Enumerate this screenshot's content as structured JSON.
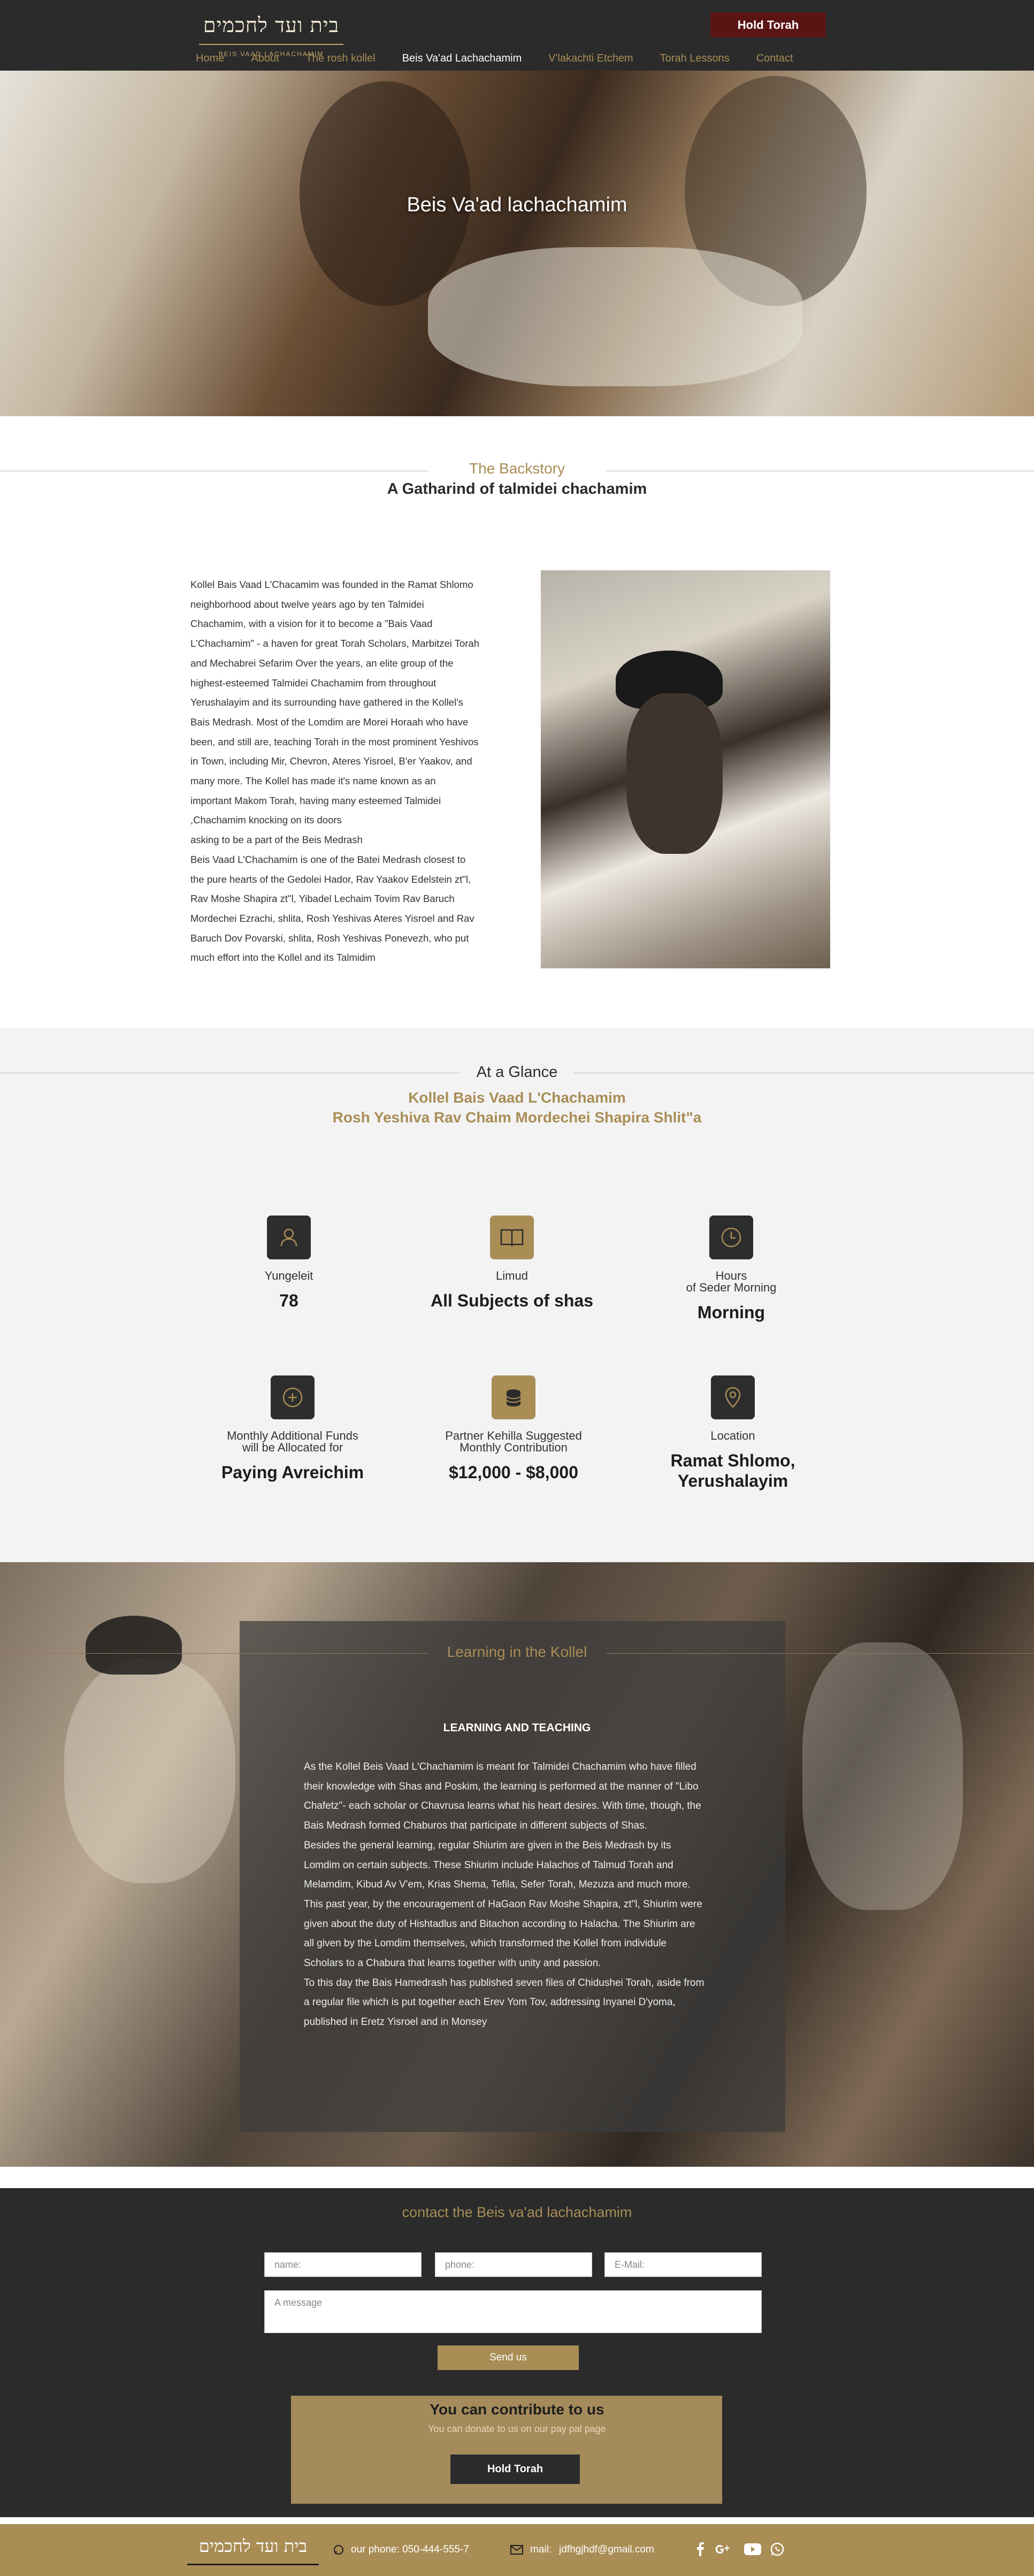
{
  "header": {
    "logo_text": "בית ועד לחכמים",
    "logo_sub": "BEIS VAAD LACHACHAMIM",
    "cta_label": "Hold  Torah",
    "nav": [
      "Home",
      "About",
      "The rosh kollel",
      "Beis Va'ad Lachachamim",
      "V'lakachti Etchem",
      "Torah Lessons",
      "Contact"
    ],
    "active_nav": "Beis Va'ad Lachachamim"
  },
  "hero": {
    "title": "Beis Va'ad lachachamim"
  },
  "backstory": {
    "kicker": "The Backstory",
    "title": "A Gatharind of talmidei chachamim",
    "body": "Kollel Bais Vaad L'Chacamim was founded in the Ramat Shlomo\nneighborhood about twelve years ago by ten Talmidei\nChachamim, with a vision for it to become a \"Bais Vaad\nL'Chachamim\" - a haven for great Torah Scholars, Marbitzei Torah\nand Mechabrei Sefarim Over the years, an elite group of the\nhighest-esteemed Talmidei Chachamim from throughout\nYerushalayim and its surrounding have gathered in the Kollel's\nBais Medrash. Most of the Lomdim are Morei Horaah who have\nbeen, and still are, teaching Torah in the most prominent Yeshivos\nin Town, including Mir, Chevron, Ateres Yisroel, B'er Yaakov, and\nmany more. The Kollel has made it's name known as an\nimportant Makom Torah, having many esteemed Talmidei\n,Chachamim knocking on its doors\nasking to be a part of the Beis Medrash\nBeis Vaad L'Chachamim is one of the Batei Medrash closest to\nthe pure hearts of the Gedolei Hador, Rav Yaakov Edelstein zt\"l,\nRav Moshe Shapira zt\"l, Yibadel Lechaim Tovim Rav Baruch\nMordechei Ezrachi, shlita, Rosh Yeshivas Ateres Yisroel and Rav\nBaruch Dov Povarski, shlita, Rosh Yeshivas Ponevezh, who put\n much effort into the Kollel and its Talmidim"
  },
  "glance": {
    "title": "At a Glance",
    "subtitle1": "Kollel Bais Vaad L'Chachamim",
    "subtitle2": "Rosh Yeshiva Rav Chaim Mordechei Shapira Shlit\"a",
    "stats": [
      {
        "icon": "person-icon",
        "label": "Yungeleit",
        "value": "78"
      },
      {
        "icon": "book-icon",
        "label": "Limud",
        "value": "All Subjects of shas"
      },
      {
        "icon": "clock-icon",
        "label": "Hours\nof Seder Morning",
        "value": "Morning"
      },
      {
        "icon": "plus-circle-icon",
        "label": "Monthly Additional Funds\nwill be Allocated for",
        "value": "Paying Avreichim"
      },
      {
        "icon": "coins-icon",
        "label": "Partner Kehilla Suggested\nMonthly Contribution",
        "value": "$12,000 - $8,000"
      },
      {
        "icon": "location-pin-icon",
        "label": "Location",
        "value": "Ramat Shlomo,\nYerushalayim"
      }
    ]
  },
  "learning": {
    "title": "Learning in the Kollel",
    "heading": "LEARNING AND TEACHING",
    "body": "As the Kollel Beis Vaad L'Chachamim is meant for Talmidei Chachamim who have filled\ntheir knowledge with Shas and Poskim, the learning is performed at the manner of \"Libo\nChafetz\"- each scholar or Chavrusa learns what his heart desires. With time, though, the\nBais Medrash formed Chaburos that participate in different subjects of Shas.\nBesides the general learning, regular Shiurim are given in the Beis Medrash by its\nLomdim on certain subjects. These Shiurim include Halachos of Talmud Torah and\nMelamdim, Kibud Av V'em, Krias Shema, Tefila, Sefer Torah, Mezuza and much more.\nThis past year, by the encouragement of HaGaon Rav Moshe Shapira, zt\"l, Shiurim were\ngiven about the duty of Hishtadlus and Bitachon according to Halacha. The Shiurim are\nall given by the Lomdim themselves, which transformed the Kollel from individule\nScholars to a Chabura that learns together with unity and passion.\nTo this day the Bais Hamedrash has published seven files of Chidushei Torah, aside from\na regular file which is put together each Erev Yom Tov, addressing Inyanei D'yoma,\npublished in Eretz Yisroel and in Monsey"
  },
  "contact": {
    "title": "contact the Beis va'ad lachachamim",
    "name_placeholder": "name:",
    "phone_placeholder": "phone:",
    "email_placeholder": "E-Mail:",
    "message_placeholder": "A message",
    "send_label": "Send us",
    "donate_title": "You can contribute to us",
    "donate_text": "You can donate to us on our pay pal page",
    "donate_button": "Hold Torah"
  },
  "footer": {
    "logo_text": "בית ועד לחכמים",
    "phone": "our phone: 050-444-555-7",
    "mail_label": "mail:",
    "email": "jdfhgjhdf@gmail.com",
    "social": [
      "facebook-icon",
      "google-plus-icon",
      "youtube-icon",
      "whatsapp-icon"
    ]
  },
  "colors": {
    "gold": "#a98d55",
    "dark": "#2b2b2b",
    "cta": "#5b1414"
  }
}
